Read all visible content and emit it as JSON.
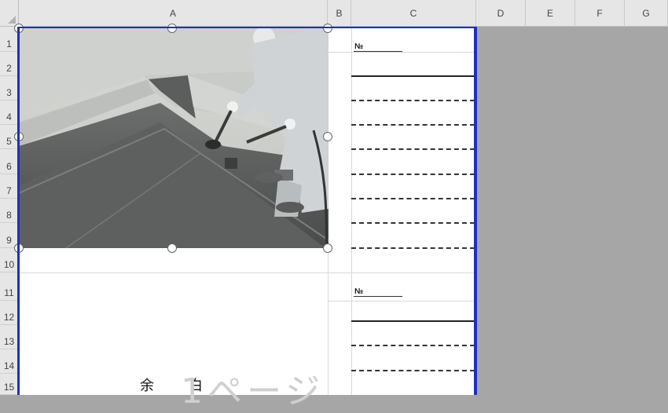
{
  "columns": [
    "A",
    "B",
    "C",
    "D",
    "E",
    "F",
    "G"
  ],
  "rows": [
    "1",
    "2",
    "3",
    "4",
    "5",
    "6",
    "7",
    "8",
    "9",
    "10",
    "11",
    "12",
    "13",
    "14",
    "15"
  ],
  "form_blocks": [
    {
      "no_label": "№"
    },
    {
      "no_label": "№"
    }
  ],
  "blank_text": {
    "char1": "余",
    "char2": "白"
  },
  "page_watermark": "1ページ",
  "photo": {
    "icon": "roof-waterproofing-photo"
  },
  "colors": {
    "page_border": "#1f2fbf",
    "outside_print_area": "#a6a6a6",
    "header_bg": "#e6e6e6"
  }
}
